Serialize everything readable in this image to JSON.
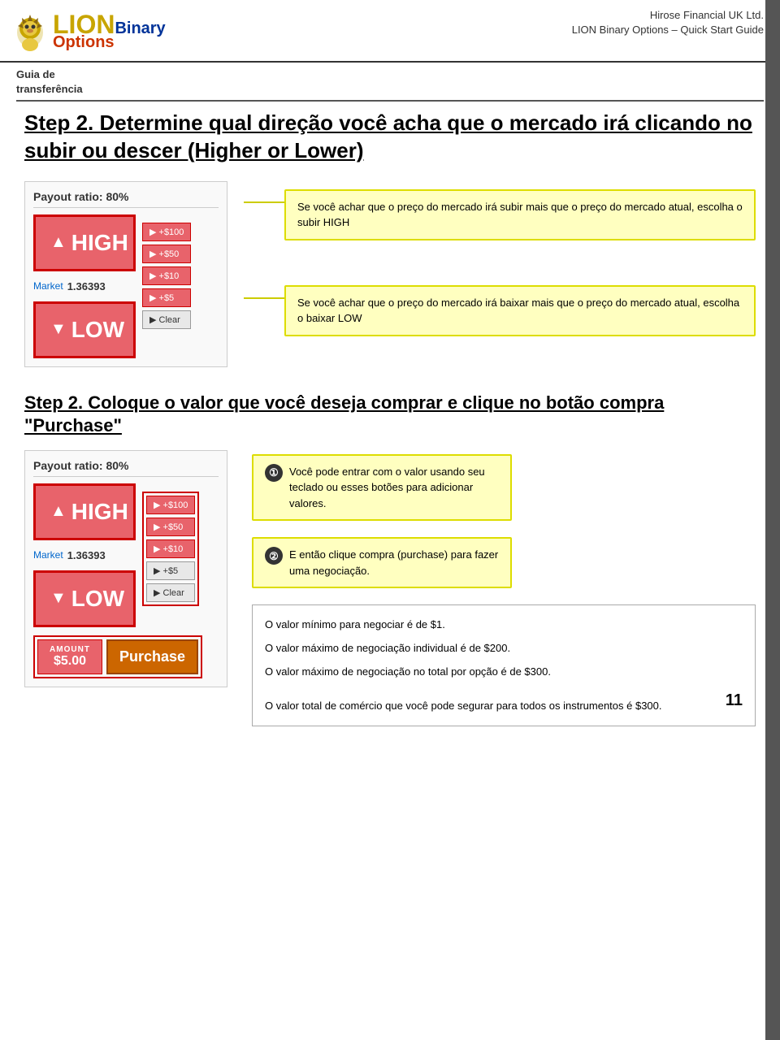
{
  "header": {
    "company_line1": "Hirose Financial UK Ltd.",
    "company_line2": "LION Binary Options – Quick Start Guide"
  },
  "breadcrumb": {
    "line1": "Guia de",
    "line2": "transferência"
  },
  "step1": {
    "heading": "Step 2. Determine qual direção você acha que o mercado irá clicando no subir ou descer (Higher or Lower)"
  },
  "step2": {
    "heading": "Step 2. Coloque o valor que você deseja comprar e clique no botão compra \"Purchase\""
  },
  "trading": {
    "payout_ratio": "Payout ratio: 80%",
    "high_label": "HIGH",
    "low_label": "LOW",
    "market_label": "Market",
    "market_value": "1.36393",
    "btn_100": "▶ +$100",
    "btn_50": "▶ +$50",
    "btn_10": "▶ +$10",
    "btn_5": "▶ +$5",
    "btn_clear": "▶ Clear",
    "amount_label": "AMOUNT",
    "amount_value": "$5.00",
    "purchase_label": "Purchase"
  },
  "annotation1": {
    "high_text": "Se você achar que o preço do mercado irá subir mais que o preço do mercado atual, escolha o subir HIGH",
    "low_text": "Se você achar que o preço do mercado irá baixar mais que o preço do mercado atual, escolha o baixar LOW"
  },
  "annotation2": {
    "step1_circle": "①",
    "step1_text": "Você pode entrar com o valor usando seu teclado ou esses botões para adicionar valores.",
    "step2_circle": "②",
    "step2_text": "E então clique compra (purchase) para fazer uma negociação."
  },
  "info_box": {
    "line1": "O valor mínimo para negociar é de $1.",
    "line2": "O valor máximo de negociação individual é de $200.",
    "line3": "O valor máximo de negociação no total por opção é de $300.",
    "line4": "O valor total de comércio que você pode segurar para todos os instrumentos é $300.",
    "page_number": "11"
  }
}
